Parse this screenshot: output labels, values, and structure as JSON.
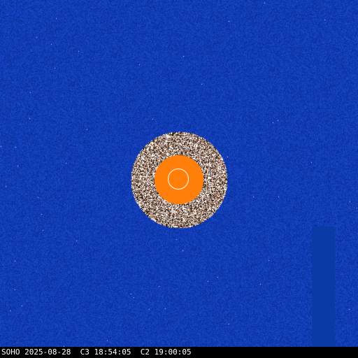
{
  "image": {
    "observatory": "SOHO",
    "date": "2025-08-28",
    "c3_label": "C3",
    "c3_time": "18:54:05",
    "c2_label": "C2",
    "c2_time": "19:00:05"
  },
  "colors": {
    "background": "#0d3bb3",
    "occulter": "#ff7f0a",
    "sun_limb": "#ffffff",
    "footer_bg": "#000000",
    "footer_text": "#ffffff"
  }
}
